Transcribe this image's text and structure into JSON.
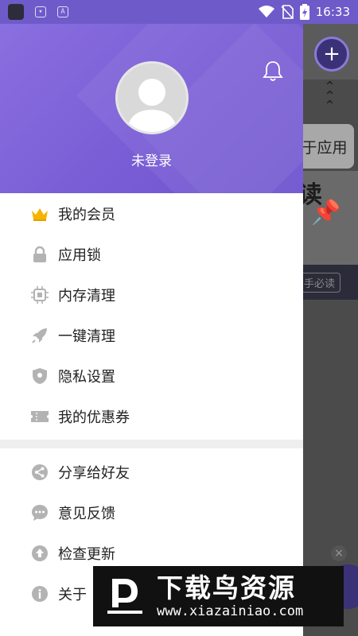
{
  "status_bar": {
    "time": "16:33",
    "icons": [
      "app-icon",
      "shield-icon",
      "a-icon",
      "wifi-icon",
      "no-sim-icon",
      "battery-charging-icon"
    ],
    "shield_glyph": "▾",
    "a_glyph": "A"
  },
  "drawer": {
    "login_text": "未登录",
    "menu_group_1": [
      {
        "label": "我的会员",
        "icon": "crown-icon",
        "color": "#f5b400"
      },
      {
        "label": "应用锁",
        "icon": "lock-icon"
      },
      {
        "label": "内存清理",
        "icon": "chip-icon"
      },
      {
        "label": "一键清理",
        "icon": "rocket-icon"
      },
      {
        "label": "隐私设置",
        "icon": "shield-icon"
      },
      {
        "label": "我的优惠券",
        "icon": "ticket-icon"
      }
    ],
    "menu_group_2": [
      {
        "label": "分享给好友",
        "icon": "share-icon"
      },
      {
        "label": "意见反馈",
        "icon": "feedback-icon"
      },
      {
        "label": "检查更新",
        "icon": "upload-icon"
      },
      {
        "label": "关于",
        "icon": "info-icon"
      }
    ]
  },
  "background_app": {
    "plus_glyph": "+",
    "card_text": "于应用",
    "big_text": "读",
    "pin_glyph": "📌",
    "tag_text": "手必读",
    "close_glyph": "×"
  },
  "watermark": {
    "title": "下载鸟资源",
    "url": "www.xiazainiao.com"
  },
  "colors": {
    "header_purple": "#7a5ed6",
    "icon_gray": "#b3b3b3",
    "crown_gold": "#f5b400"
  }
}
